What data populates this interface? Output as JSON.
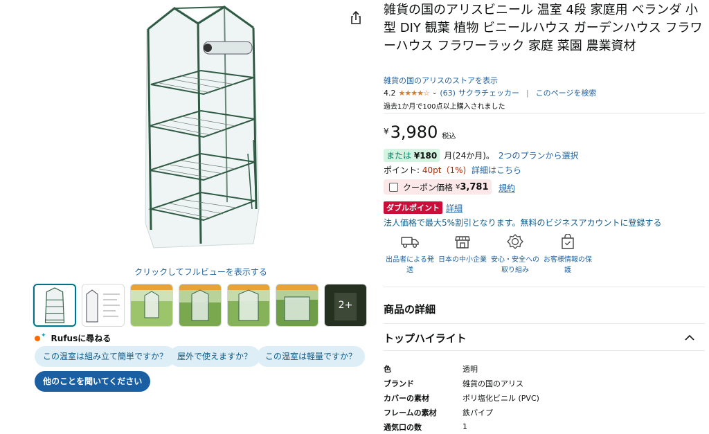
{
  "product": {
    "title": "雑貨の国のアリスビニール 温室 4段 家庭用 ベランダ 小型 DIY 観葉 植物 ビニールハウス ガーデンハウス フラワーハウス フラワーラック 家庭 菜園 農業資材",
    "store_link": "雑貨の国のアリスのストアを表示",
    "rating_value": "4.2",
    "rating_count": "(63)",
    "sakura_checker": "サクラチェッカー",
    "search_page": "このページを検索",
    "bought_past_month": "過去1か月で100点以上購入されました"
  },
  "price": {
    "currency": "¥",
    "amount": "3,980",
    "tax_label": "税込"
  },
  "installment": {
    "prefix": "または",
    "amount": "¥180",
    "suffix": "月(24か月)。",
    "link": "2つのプランから選択"
  },
  "points": {
    "label": "ポイント:",
    "value": "40pt（1%)",
    "link": "詳細はこちら"
  },
  "coupon": {
    "label": "クーポン価格",
    "currency": "¥",
    "price": "3,781",
    "terms": "規約"
  },
  "double_points": {
    "badge": "ダブルポイント",
    "link": "詳細"
  },
  "business": {
    "text": "法人価格で最大5%割引となります。無料のビジネスアカウントに登録する"
  },
  "features": [
    {
      "line1": "出品者による発",
      "line2": "送",
      "icon": "truck-icon"
    },
    {
      "line1": "日本の中小企業",
      "line2": "",
      "icon": "store-icon"
    },
    {
      "line1": "安心・安全への",
      "line2": "取り組み",
      "icon": "shield-badge-icon"
    },
    {
      "line1": "お客様情報の保",
      "line2": "護",
      "icon": "lock-bag-icon"
    }
  ],
  "sections": {
    "details": "商品の詳細",
    "highlights": "トップハイライト"
  },
  "specs": [
    {
      "key": "色",
      "value": "透明"
    },
    {
      "key": "ブランド",
      "value": "雑貨の国のアリス"
    },
    {
      "key": "カバーの素材",
      "value": "ポリ塩化ビニル (PVC)"
    },
    {
      "key": "フレームの素材",
      "value": "鉄パイプ"
    },
    {
      "key": "通気口の数",
      "value": "1"
    }
  ],
  "gallery": {
    "fullview_link": "クリックしてフルビューを表示する",
    "more_count": "2+",
    "selected_index": 0
  },
  "rufus": {
    "title": "Rufusに尋ねる",
    "chips": [
      "この温室は組み立て簡単ですか？",
      "屋外で使えますか？",
      "この温室は軽量ですか？"
    ],
    "ask_more": "他のことを聞いてください"
  },
  "colors": {
    "link": "#2162a1",
    "star": "#de7921",
    "points_red": "#b12704",
    "double_badge": "#cc0c39",
    "coupon_bg": "#fce8e8",
    "install_bg": "#d4f3e0",
    "chip_bg": "#ddeef7",
    "chip_dark": "#1b5fa3"
  }
}
